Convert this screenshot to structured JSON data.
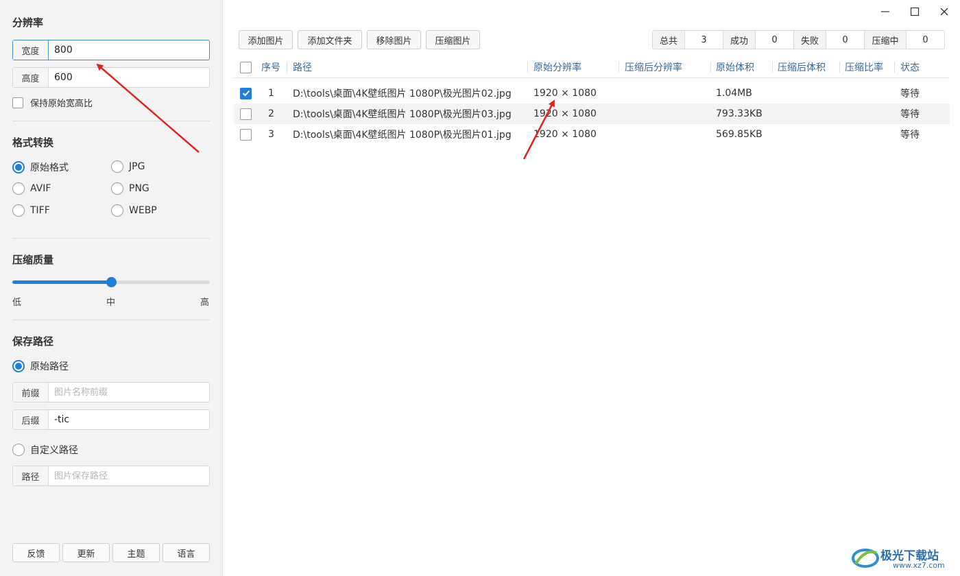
{
  "sidebar": {
    "resolution": {
      "title": "分辨率",
      "width_label": "宽度",
      "width_value": "800",
      "height_label": "高度",
      "height_value": "600",
      "keep_ratio_label": "保持原始宽高比"
    },
    "format": {
      "title": "格式转换",
      "options": [
        "原始格式",
        "JPG",
        "AVIF",
        "PNG",
        "TIFF",
        "WEBP"
      ],
      "selected": "原始格式"
    },
    "quality": {
      "title": "压缩质量",
      "low": "低",
      "mid": "中",
      "high": "高",
      "level": 0.5
    },
    "save": {
      "title": "保存路径",
      "original_path_label": "原始路径",
      "prefix_label": "前缀",
      "prefix_placeholder": "图片名称前缀",
      "prefix_value": "",
      "suffix_label": "后缀",
      "suffix_value": "-tic",
      "custom_path_label": "自定义路径",
      "path_label": "路径",
      "path_placeholder": "图片保存路径",
      "path_value": ""
    },
    "bottom": {
      "feedback": "反馈",
      "update": "更新",
      "theme": "主题",
      "language": "语言"
    }
  },
  "toolbar": {
    "add_image": "添加图片",
    "add_folder": "添加文件夹",
    "remove_image": "移除图片",
    "compress_image": "压缩图片"
  },
  "stats": {
    "total_label": "总共",
    "total": "3",
    "success_label": "成功",
    "success": "0",
    "fail_label": "失败",
    "fail": "0",
    "progress_label": "压缩中",
    "progress": "0"
  },
  "table": {
    "headers": {
      "index": "序号",
      "path": "路径",
      "orig_res": "原始分辨率",
      "new_res": "压缩后分辨率",
      "orig_size": "原始体积",
      "new_size": "压缩后体积",
      "ratio": "压缩比率",
      "status": "状态"
    },
    "rows": [
      {
        "checked": true,
        "index": "1",
        "path": "D:\\tools\\桌面\\4K壁纸图片 1080P\\极光图片02.jpg",
        "orig_res": "1920 × 1080",
        "new_res": "",
        "orig_size": "1.04MB",
        "new_size": "",
        "ratio": "",
        "status": "等待"
      },
      {
        "checked": false,
        "index": "2",
        "path": "D:\\tools\\桌面\\4K壁纸图片 1080P\\极光图片03.jpg",
        "orig_res": "1920 × 1080",
        "new_res": "",
        "orig_size": "793.33KB",
        "new_size": "",
        "ratio": "",
        "status": "等待"
      },
      {
        "checked": false,
        "index": "3",
        "path": "D:\\tools\\桌面\\4K壁纸图片 1080P\\极光图片01.jpg",
        "orig_res": "1920 × 1080",
        "new_res": "",
        "orig_size": "569.85KB",
        "new_size": "",
        "ratio": "",
        "status": "等待"
      }
    ]
  },
  "watermark": {
    "brand": "极光下载站",
    "url": "www.xz7.com"
  },
  "colors": {
    "accent": "#1e7fd6",
    "annotation_arrow": "#e0231c",
    "header_text": "#3c6b97"
  }
}
